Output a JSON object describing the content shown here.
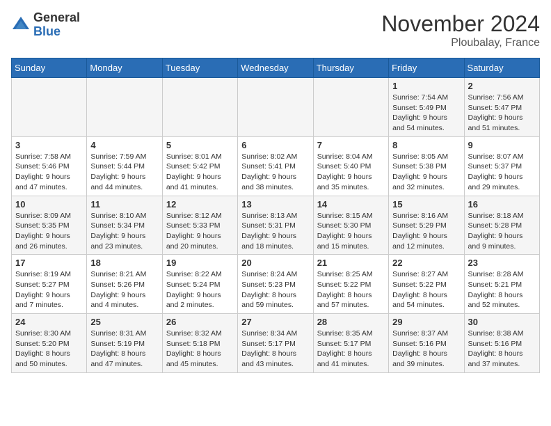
{
  "header": {
    "logo": {
      "general": "General",
      "blue": "Blue"
    },
    "title": "November 2024",
    "location": "Ploubalay, France"
  },
  "weekdays": [
    "Sunday",
    "Monday",
    "Tuesday",
    "Wednesday",
    "Thursday",
    "Friday",
    "Saturday"
  ],
  "weeks": [
    [
      null,
      null,
      null,
      null,
      null,
      {
        "day": 1,
        "sunrise": "Sunrise: 7:54 AM",
        "sunset": "Sunset: 5:49 PM",
        "daylight": "Daylight: 9 hours and 54 minutes."
      },
      {
        "day": 2,
        "sunrise": "Sunrise: 7:56 AM",
        "sunset": "Sunset: 5:47 PM",
        "daylight": "Daylight: 9 hours and 51 minutes."
      }
    ],
    [
      {
        "day": 3,
        "sunrise": "Sunrise: 7:58 AM",
        "sunset": "Sunset: 5:46 PM",
        "daylight": "Daylight: 9 hours and 47 minutes."
      },
      {
        "day": 4,
        "sunrise": "Sunrise: 7:59 AM",
        "sunset": "Sunset: 5:44 PM",
        "daylight": "Daylight: 9 hours and 44 minutes."
      },
      {
        "day": 5,
        "sunrise": "Sunrise: 8:01 AM",
        "sunset": "Sunset: 5:42 PM",
        "daylight": "Daylight: 9 hours and 41 minutes."
      },
      {
        "day": 6,
        "sunrise": "Sunrise: 8:02 AM",
        "sunset": "Sunset: 5:41 PM",
        "daylight": "Daylight: 9 hours and 38 minutes."
      },
      {
        "day": 7,
        "sunrise": "Sunrise: 8:04 AM",
        "sunset": "Sunset: 5:40 PM",
        "daylight": "Daylight: 9 hours and 35 minutes."
      },
      {
        "day": 8,
        "sunrise": "Sunrise: 8:05 AM",
        "sunset": "Sunset: 5:38 PM",
        "daylight": "Daylight: 9 hours and 32 minutes."
      },
      {
        "day": 9,
        "sunrise": "Sunrise: 8:07 AM",
        "sunset": "Sunset: 5:37 PM",
        "daylight": "Daylight: 9 hours and 29 minutes."
      }
    ],
    [
      {
        "day": 10,
        "sunrise": "Sunrise: 8:09 AM",
        "sunset": "Sunset: 5:35 PM",
        "daylight": "Daylight: 9 hours and 26 minutes."
      },
      {
        "day": 11,
        "sunrise": "Sunrise: 8:10 AM",
        "sunset": "Sunset: 5:34 PM",
        "daylight": "Daylight: 9 hours and 23 minutes."
      },
      {
        "day": 12,
        "sunrise": "Sunrise: 8:12 AM",
        "sunset": "Sunset: 5:33 PM",
        "daylight": "Daylight: 9 hours and 20 minutes."
      },
      {
        "day": 13,
        "sunrise": "Sunrise: 8:13 AM",
        "sunset": "Sunset: 5:31 PM",
        "daylight": "Daylight: 9 hours and 18 minutes."
      },
      {
        "day": 14,
        "sunrise": "Sunrise: 8:15 AM",
        "sunset": "Sunset: 5:30 PM",
        "daylight": "Daylight: 9 hours and 15 minutes."
      },
      {
        "day": 15,
        "sunrise": "Sunrise: 8:16 AM",
        "sunset": "Sunset: 5:29 PM",
        "daylight": "Daylight: 9 hours and 12 minutes."
      },
      {
        "day": 16,
        "sunrise": "Sunrise: 8:18 AM",
        "sunset": "Sunset: 5:28 PM",
        "daylight": "Daylight: 9 hours and 9 minutes."
      }
    ],
    [
      {
        "day": 17,
        "sunrise": "Sunrise: 8:19 AM",
        "sunset": "Sunset: 5:27 PM",
        "daylight": "Daylight: 9 hours and 7 minutes."
      },
      {
        "day": 18,
        "sunrise": "Sunrise: 8:21 AM",
        "sunset": "Sunset: 5:26 PM",
        "daylight": "Daylight: 9 hours and 4 minutes."
      },
      {
        "day": 19,
        "sunrise": "Sunrise: 8:22 AM",
        "sunset": "Sunset: 5:24 PM",
        "daylight": "Daylight: 9 hours and 2 minutes."
      },
      {
        "day": 20,
        "sunrise": "Sunrise: 8:24 AM",
        "sunset": "Sunset: 5:23 PM",
        "daylight": "Daylight: 8 hours and 59 minutes."
      },
      {
        "day": 21,
        "sunrise": "Sunrise: 8:25 AM",
        "sunset": "Sunset: 5:22 PM",
        "daylight": "Daylight: 8 hours and 57 minutes."
      },
      {
        "day": 22,
        "sunrise": "Sunrise: 8:27 AM",
        "sunset": "Sunset: 5:22 PM",
        "daylight": "Daylight: 8 hours and 54 minutes."
      },
      {
        "day": 23,
        "sunrise": "Sunrise: 8:28 AM",
        "sunset": "Sunset: 5:21 PM",
        "daylight": "Daylight: 8 hours and 52 minutes."
      }
    ],
    [
      {
        "day": 24,
        "sunrise": "Sunrise: 8:30 AM",
        "sunset": "Sunset: 5:20 PM",
        "daylight": "Daylight: 8 hours and 50 minutes."
      },
      {
        "day": 25,
        "sunrise": "Sunrise: 8:31 AM",
        "sunset": "Sunset: 5:19 PM",
        "daylight": "Daylight: 8 hours and 47 minutes."
      },
      {
        "day": 26,
        "sunrise": "Sunrise: 8:32 AM",
        "sunset": "Sunset: 5:18 PM",
        "daylight": "Daylight: 8 hours and 45 minutes."
      },
      {
        "day": 27,
        "sunrise": "Sunrise: 8:34 AM",
        "sunset": "Sunset: 5:17 PM",
        "daylight": "Daylight: 8 hours and 43 minutes."
      },
      {
        "day": 28,
        "sunrise": "Sunrise: 8:35 AM",
        "sunset": "Sunset: 5:17 PM",
        "daylight": "Daylight: 8 hours and 41 minutes."
      },
      {
        "day": 29,
        "sunrise": "Sunrise: 8:37 AM",
        "sunset": "Sunset: 5:16 PM",
        "daylight": "Daylight: 8 hours and 39 minutes."
      },
      {
        "day": 30,
        "sunrise": "Sunrise: 8:38 AM",
        "sunset": "Sunset: 5:16 PM",
        "daylight": "Daylight: 8 hours and 37 minutes."
      }
    ]
  ]
}
